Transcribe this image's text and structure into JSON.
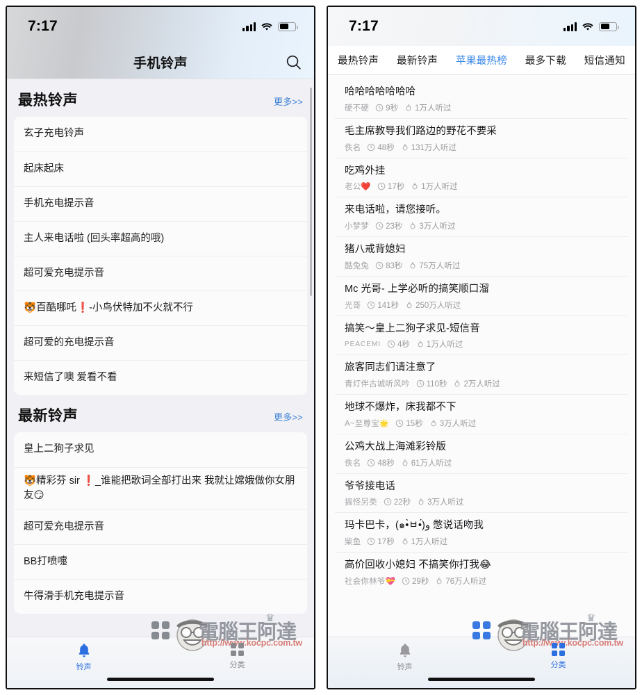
{
  "colors": {
    "accent_blue": "#2b6fe0",
    "tab_active_blue": "#3a88e8",
    "more_link_blue": "#3a7fd5",
    "meta_grey": "#9a9a9e",
    "watermark_grey": "#8e9199",
    "watermark_red": "#d4736e"
  },
  "watermark": {
    "brand": "電腦王阿達",
    "url": "http://www.kocpc.com.tw",
    "crown": "♛"
  },
  "left_phone": {
    "status_bar": {
      "time": "7:17",
      "signal_icon": "cellular-bars-icon",
      "wifi_icon": "wifi-icon",
      "battery_icon": "battery-icon"
    },
    "header": {
      "title": "手机铃声",
      "search_icon": "search-icon"
    },
    "sections": [
      {
        "title": "最热铃声",
        "more_label": "更多>>",
        "items": [
          {
            "title": "玄子充电铃声"
          },
          {
            "title": "起床起床"
          },
          {
            "title": "手机充电提示音"
          },
          {
            "title": "主人来电话啦 (回头率超高的哦)"
          },
          {
            "title": "超可爱充电提示音"
          },
          {
            "title": "🐯百酷哪吒❗-小鸟伏特加不火就不行"
          },
          {
            "title": "超可爱的充电提示音"
          },
          {
            "title": "来短信了噢 爱看不看"
          }
        ]
      },
      {
        "title": "最新铃声",
        "more_label": "更多>>",
        "items": [
          {
            "title": "皇上二狗子求见"
          },
          {
            "title": "🐯精彩芬 sir ❗_谁能把歌词全部打出来  我就让嫦娥做你女朋友😏"
          },
          {
            "title": "超可爱充电提示音"
          },
          {
            "title": "BB打喷嚏"
          },
          {
            "title": "牛得滑手机充电提示音"
          }
        ]
      }
    ],
    "tabbar": [
      {
        "label": "铃声",
        "icon": "bell-icon",
        "active": true
      },
      {
        "label": "分类",
        "icon": "grid-icon",
        "active": false
      }
    ]
  },
  "right_phone": {
    "status_bar": {
      "time": "7:17",
      "signal_icon": "cellular-bars-icon",
      "wifi_icon": "wifi-icon",
      "battery_icon": "battery-icon"
    },
    "tabs": [
      {
        "label": "最热铃声",
        "active": false
      },
      {
        "label": "最新铃声",
        "active": false
      },
      {
        "label": "苹果最热榜",
        "active": true
      },
      {
        "label": "最多下载",
        "active": false
      },
      {
        "label": "短信通知",
        "active": false
      }
    ],
    "list": [
      {
        "title": "哈哈哈哈哈哈哈",
        "author": "硬不硬",
        "duration": "9秒",
        "plays": "1万人听过"
      },
      {
        "title": "毛主席教导我们路边的野花不要采",
        "author": "佚名",
        "duration": "48秒",
        "plays": "131万人听过"
      },
      {
        "title": "吃鸡外挂",
        "author": "老公❤️",
        "duration": "17秒",
        "plays": "1万人听过"
      },
      {
        "title": "来电话啦，请您接听。",
        "author": "小梦梦",
        "duration": "23秒",
        "plays": "3万人听过"
      },
      {
        "title": "猪八戒背媳妇",
        "author": "酷兔兔",
        "duration": "83秒",
        "plays": "75万人听过"
      },
      {
        "title": "Mc 光哥- 上学必听的搞笑顺口溜",
        "author": "光哥",
        "duration": "141秒",
        "plays": "250万人听过"
      },
      {
        "title": "搞笑〜皇上二狗子求见-短信音",
        "author": "PEACEMI",
        "author_small": true,
        "duration": "4秒",
        "plays": "1万人听过"
      },
      {
        "title": "旅客同志们请注意了",
        "author": "青灯伴古城听风吟",
        "duration": "110秒",
        "plays": "2万人听过"
      },
      {
        "title": "地球不爆炸，床我都不下",
        "author": "A~至尊宝🌟",
        "duration": "15秒",
        "plays": "3万人听过"
      },
      {
        "title": "公鸡大战上海滩彩铃版",
        "author": "佚名",
        "duration": "48秒",
        "plays": "61万人听过"
      },
      {
        "title": "爷爷接电话",
        "author": "搞怪另类",
        "duration": "22秒",
        "plays": "3万人听过"
      },
      {
        "title": "玛卡巴卡，(๑•̀ㅂ•́)و 憋说话吻我",
        "author": "柴鱼",
        "duration": "17秒",
        "plays": "1万人听过"
      },
      {
        "title": "高价回收小媳妇  不搞笑你打我😂",
        "author": "社会你林爷💝",
        "duration": "29秒",
        "plays": "76万人听过"
      }
    ],
    "tabbar": [
      {
        "label": "铃声",
        "icon": "bell-icon",
        "active": false
      },
      {
        "label": "分类",
        "icon": "grid-icon",
        "active": true
      }
    ]
  }
}
